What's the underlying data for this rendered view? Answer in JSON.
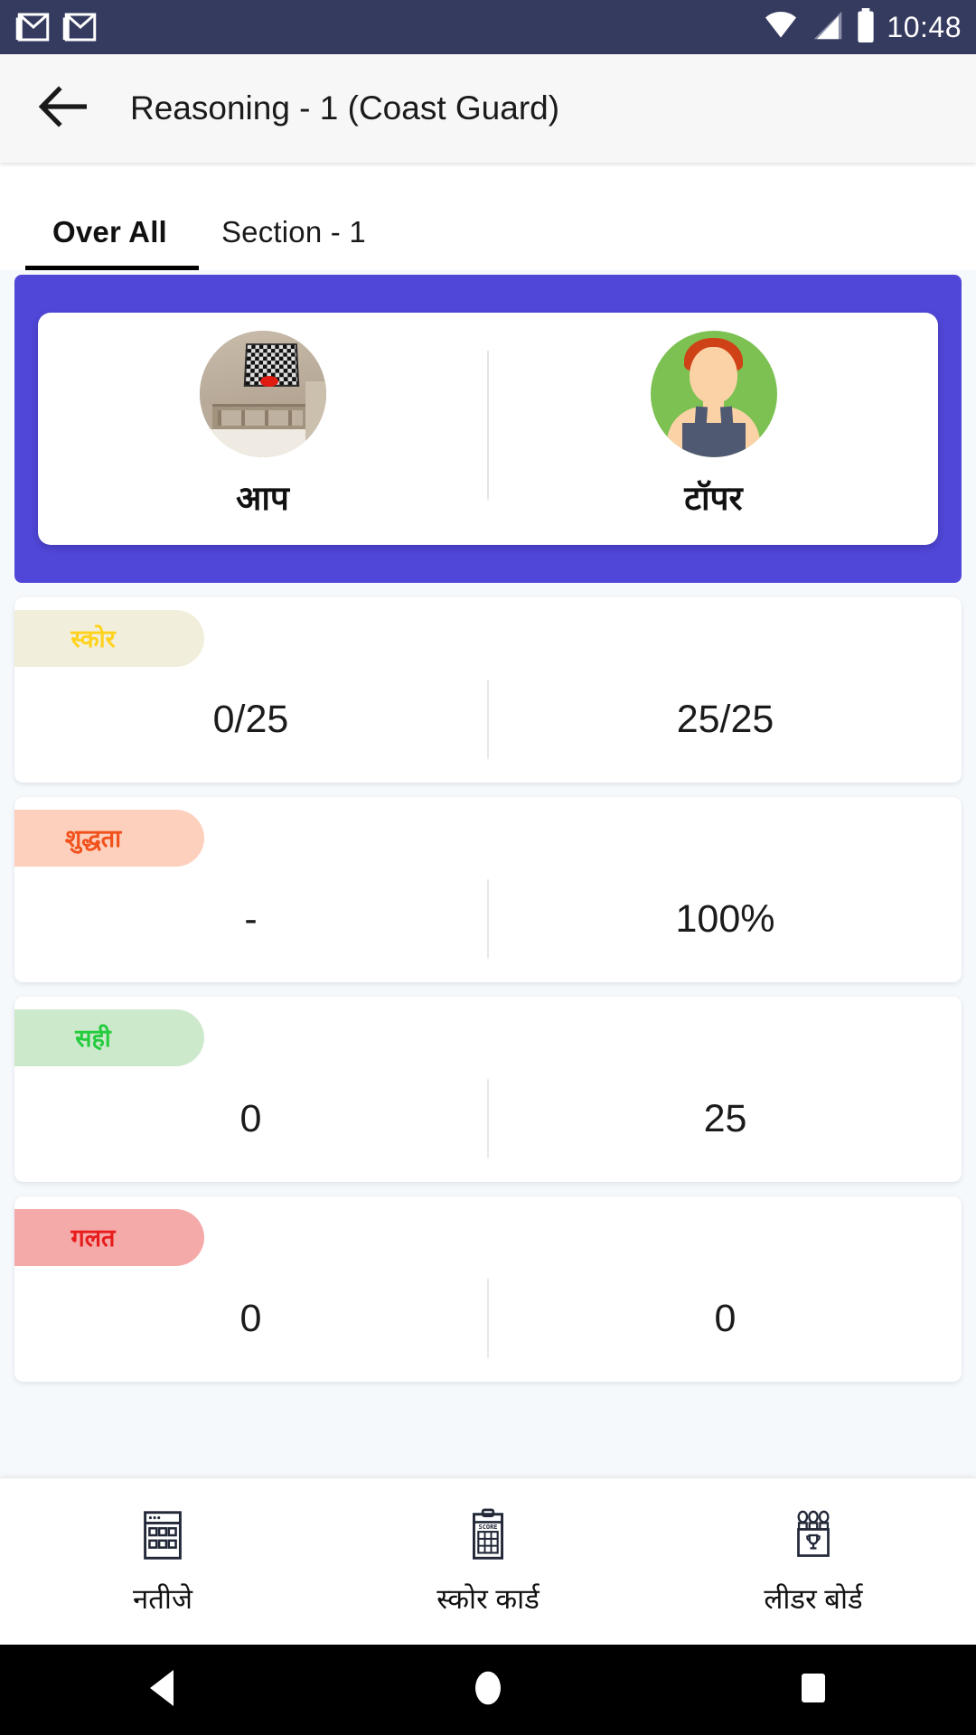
{
  "status_bar": {
    "time": "10:48",
    "icons": [
      "gmail-icon",
      "gmail-icon",
      "wifi-icon",
      "signal-icon",
      "battery-icon"
    ]
  },
  "app_bar": {
    "back_icon": "back-arrow-icon",
    "title": "Reasoning - 1 (Coast Guard)"
  },
  "tabs": {
    "items": [
      {
        "label": "Over All",
        "active": true
      },
      {
        "label": "Section - 1",
        "active": false
      }
    ]
  },
  "hero": {
    "background_color": "#5046d7",
    "you": {
      "label": "आप",
      "avatar": "user-photo-avatar"
    },
    "topper": {
      "label": "टॉपर",
      "avatar": "topper-illustration-avatar"
    }
  },
  "stats": [
    {
      "chip_label": "स्कोर",
      "chip_bg": "#f1efdb",
      "chip_color": "#ffd21e",
      "you_value": "0/25",
      "topper_value": "25/25"
    },
    {
      "chip_label": "शुद्धता",
      "chip_bg": "#fcd0bc",
      "chip_color": "#f2511b",
      "you_value": "-",
      "topper_value": "100%"
    },
    {
      "chip_label": "सही",
      "chip_bg": "#cde9cc",
      "chip_color": "#25cc3e",
      "you_value": "0",
      "topper_value": "25"
    },
    {
      "chip_label": "गलत",
      "chip_bg": "#f5aaaa",
      "chip_color": "#e71d1d",
      "you_value": "0",
      "topper_value": "0"
    }
  ],
  "bottom_nav": {
    "items": [
      {
        "label": "नतीजे",
        "icon": "results-grid-icon"
      },
      {
        "label": "स्कोर कार्ड",
        "icon": "score-clipboard-icon"
      },
      {
        "label": "लीडर बोर्ड",
        "icon": "leaderboard-podium-icon"
      }
    ]
  },
  "android_nav": {
    "back": "triangle-back-icon",
    "home": "circle-home-icon",
    "recents": "square-recents-icon"
  }
}
